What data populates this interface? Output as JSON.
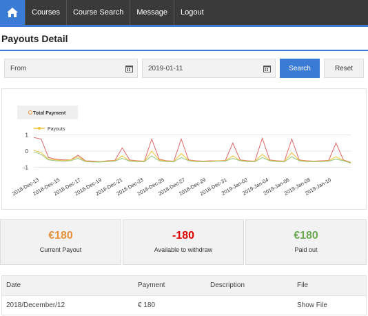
{
  "nav": {
    "items": [
      {
        "label": "Courses"
      },
      {
        "label": "Course Search"
      },
      {
        "label": "Message"
      },
      {
        "label": "Logout"
      }
    ],
    "accent": "#3a7bd5",
    "home_icon": "home-icon"
  },
  "page": {
    "title": "Payouts Detail"
  },
  "filters": {
    "from_placeholder": "From",
    "to_value": "2019-01-11",
    "search_label": "Search",
    "reset_label": "Reset"
  },
  "chart_data": {
    "type": "line",
    "legend_title": "Total Payment",
    "series_labels": [
      "Payouts"
    ],
    "legend_placement": "top-left",
    "yticks": [
      1,
      0,
      -1
    ],
    "ylim": [
      -1.2,
      1.2
    ],
    "tick_labels": [
      "2018-Dec-13",
      "2018-Dec-15",
      "2018-Dec-17",
      "2018-Dec-19",
      "2018-Dec-21",
      "2018-Dec-23",
      "2018-Dec-25",
      "2018-Dec-27",
      "2018-Dec-29",
      "2018-Dec-31",
      "2019-Jan-02",
      "2019-Jan-04",
      "2019-Jan-06",
      "2019-Jan-08",
      "2019-Jan-10"
    ],
    "series": [
      {
        "color": "#e06666",
        "values": [
          0.85,
          0.75,
          -0.4,
          -0.5,
          -0.55,
          -0.55,
          -0.25,
          -0.6,
          -0.62,
          -0.65,
          -0.6,
          -0.58,
          0.2,
          -0.55,
          -0.6,
          -0.62,
          0.75,
          -0.5,
          -0.6,
          -0.62,
          0.75,
          -0.55,
          -0.6,
          -0.62,
          -0.6,
          -0.6,
          -0.58,
          0.5,
          -0.55,
          -0.6,
          -0.62,
          0.8,
          -0.55,
          -0.6,
          -0.62,
          0.75,
          -0.55,
          -0.6,
          -0.62,
          -0.6,
          -0.58,
          0.5,
          -0.55,
          -0.7
        ]
      },
      {
        "color": "#f1c232",
        "values": [
          0.05,
          -0.1,
          -0.5,
          -0.55,
          -0.6,
          -0.55,
          -0.35,
          -0.62,
          -0.65,
          -0.66,
          -0.62,
          -0.6,
          -0.3,
          -0.6,
          -0.62,
          -0.63,
          0.0,
          -0.55,
          -0.62,
          -0.63,
          -0.15,
          -0.58,
          -0.62,
          -0.63,
          -0.62,
          -0.6,
          -0.6,
          -0.3,
          -0.58,
          -0.62,
          -0.63,
          -0.2,
          -0.58,
          -0.62,
          -0.63,
          -0.1,
          -0.58,
          -0.62,
          -0.63,
          -0.62,
          -0.6,
          -0.35,
          -0.58,
          -0.72
        ]
      },
      {
        "color": "#93c47d",
        "values": [
          -0.05,
          -0.2,
          -0.55,
          -0.6,
          -0.62,
          -0.6,
          -0.45,
          -0.65,
          -0.68,
          -0.68,
          -0.65,
          -0.62,
          -0.45,
          -0.62,
          -0.65,
          -0.66,
          -0.3,
          -0.6,
          -0.65,
          -0.66,
          -0.4,
          -0.6,
          -0.65,
          -0.66,
          -0.65,
          -0.62,
          -0.62,
          -0.45,
          -0.6,
          -0.65,
          -0.66,
          -0.4,
          -0.6,
          -0.65,
          -0.66,
          -0.35,
          -0.6,
          -0.65,
          -0.66,
          -0.65,
          -0.62,
          -0.5,
          -0.6,
          -0.75
        ]
      }
    ]
  },
  "summary": {
    "current_amount": "€180",
    "current_label": "Current Payout",
    "current_color": "#e69138",
    "available_amount": "-180",
    "available_label": "Available to withdraw",
    "available_color": "#e00000",
    "paid_amount": "€180",
    "paid_label": "Paid out",
    "paid_color": "#6aa84f"
  },
  "table": {
    "headers": {
      "date": "Date",
      "payment": "Payment",
      "description": "Description",
      "file": "File"
    },
    "rows": [
      {
        "date": "2018/December/12",
        "payment": "€ 180",
        "description": "",
        "file": "Show File"
      }
    ]
  }
}
